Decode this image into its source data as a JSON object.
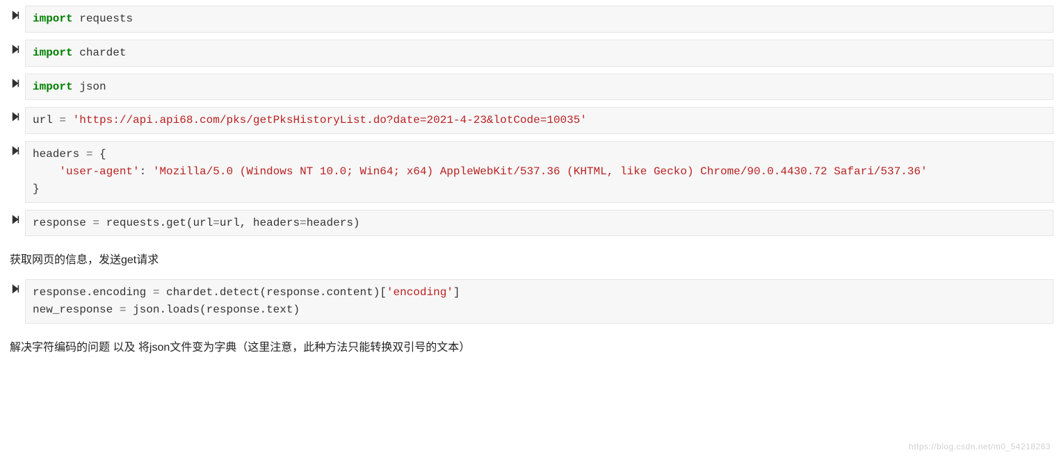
{
  "cells": [
    {
      "type": "code",
      "html": "<span class='kw'>import</span> requests"
    },
    {
      "type": "code",
      "html": "<span class='kw'>import</span> chardet"
    },
    {
      "type": "code",
      "html": "<span class='kw'>import</span> json"
    },
    {
      "type": "code",
      "html": "url <span class='op'>=</span> <span class='str'>'https://api.api68.com/pks/getPksHistoryList.do?date=2021-4-23&amp;lotCode=10035'</span>"
    },
    {
      "type": "code",
      "html": "headers <span class='op'>=</span> {\n    <span class='str'>'user-agent'</span>: <span class='str'>'Mozilla/5.0 (Windows NT 10.0; Win64; x64) AppleWebKit/537.36 (KHTML, like Gecko) Chrome/90.0.4430.72 Safari/537.36'</span>\n}"
    },
    {
      "type": "code",
      "html": "response <span class='op'>=</span> requests.get(url<span class='op'>=</span>url, headers<span class='op'>=</span>headers)"
    },
    {
      "type": "text",
      "text": "获取网页的信息，发送get请求"
    },
    {
      "type": "code",
      "html": "response.encoding <span class='op'>=</span> chardet.detect(response.content)[<span class='str'>'encoding'</span>]\nnew_response <span class='op'>=</span> json.loads(response.text)"
    },
    {
      "type": "text",
      "text": "解决字符编码的问题 以及 将json文件变为字典（这里注意，此种方法只能转换双引号的文本）"
    }
  ],
  "watermark": "https://blog.csdn.net/m0_54218263"
}
